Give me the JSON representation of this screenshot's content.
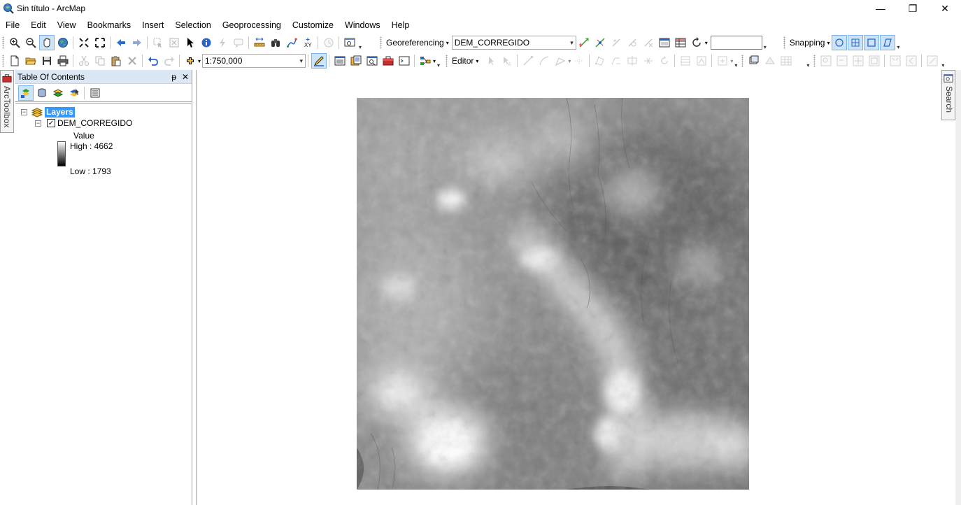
{
  "window": {
    "title": "Sin título - ArcMap",
    "minimize": "—",
    "restore": "❐",
    "close": "✕"
  },
  "menu": [
    "File",
    "Edit",
    "View",
    "Bookmarks",
    "Insert",
    "Selection",
    "Geoprocessing",
    "Customize",
    "Windows",
    "Help"
  ],
  "toolbar": {
    "georeferencing_label": "Georeferencing",
    "georeferencing_layer": "DEM_CORREGIDO",
    "snapping_label": "Snapping",
    "scale_value": "1:750,000",
    "editor_label": "Editor"
  },
  "toc": {
    "title": "Table Of Contents",
    "pin": "ᵽ",
    "close": "✕",
    "layers_label": "Layers",
    "layer": {
      "name": "DEM_CORREGIDO",
      "checked": true,
      "legend_field": "Value",
      "high_label": "High : 4662",
      "low_label": "Low : 1793"
    }
  },
  "side_tabs": {
    "left": "ArcToolbox",
    "right": "Search"
  },
  "colors": {
    "accent": "#3399ff",
    "toc_header": "#dbe7f4",
    "active_tool": "#cce4f7"
  }
}
